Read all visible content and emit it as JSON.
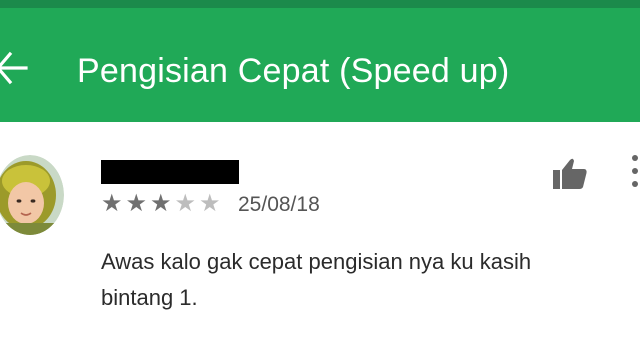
{
  "app_bar": {
    "title": "Pengisian Cepat (Speed up)",
    "back_icon": "arrow-left-icon",
    "color": "#20a957",
    "status_bar_color": "#1b8a4b"
  },
  "review": {
    "reviewer_name_redacted": true,
    "rating": 3,
    "max_rating": 5,
    "date": "25/08/18",
    "text": "Awas kalo gak cepat pengisian nya ku kasih bintang 1.",
    "thumbs_up_icon": "thumbs-up-icon",
    "more_icon": "more-vert-icon",
    "star_filled_color": "#707070",
    "star_empty_color": "#bdbdbd"
  }
}
